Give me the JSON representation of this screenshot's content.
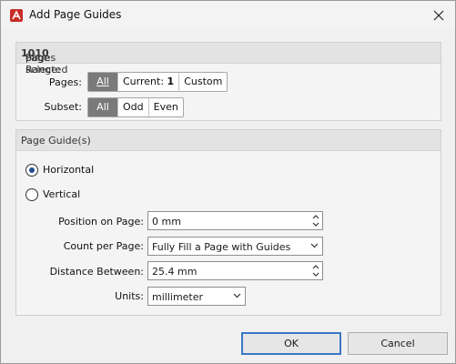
{
  "window": {
    "title": "Add Page Guides"
  },
  "page_range": {
    "prefix": "Page Range: ",
    "selected": "10",
    "of": " of ",
    "total": "10",
    "suffix": " pages selected",
    "pages_label": "Pages:",
    "pages_options": [
      {
        "label": "All",
        "active": true
      },
      {
        "label": "Current: ",
        "value": "1",
        "active": false
      },
      {
        "label": "Custom",
        "active": false
      }
    ],
    "subset_label": "Subset:",
    "subset_options": [
      {
        "label": "All",
        "active": true
      },
      {
        "label": "Odd",
        "active": false
      },
      {
        "label": "Even",
        "active": false
      }
    ]
  },
  "guides": {
    "header": "Page Guide(s)",
    "horizontal_label": "Horizontal",
    "horizontal_checked": true,
    "vertical_label": "Vertical",
    "vertical_checked": false,
    "position_label": "Position on Page:",
    "position_value": "0 mm",
    "count_label": "Count per Page:",
    "count_value": "Fully Fill a Page with Guides",
    "distance_label": "Distance Between:",
    "distance_value": "25.4 mm",
    "units_label": "Units:",
    "units_value": "millimeter"
  },
  "buttons": {
    "ok": "OK",
    "cancel": "Cancel"
  },
  "colors": {
    "accent": "#3b78c6",
    "active_segment": "#7a7a7a",
    "radio_dot": "#1f4f8f",
    "app_icon": "#c62d27"
  },
  "icons": {
    "app": "pdf-app-icon",
    "close": "close-icon",
    "spinner": "spinner-arrows-icon",
    "dropdown": "chevron-down-icon"
  }
}
